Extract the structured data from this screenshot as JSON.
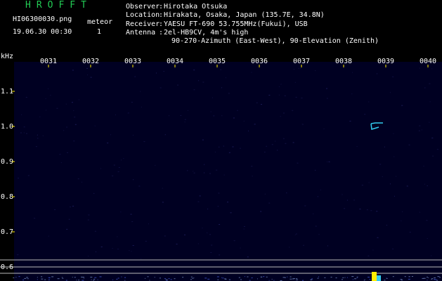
{
  "header": {
    "app_title": "HROFFT",
    "filename": "HI06300030.png",
    "datetime": "19.06.30 00:30",
    "meteor_label": "meteor",
    "meteor_count": "1"
  },
  "station": {
    "observer_label": "Observer",
    "observer": "Hirotaka Otsuka",
    "location_label": "Location",
    "location": "Hirakata, Osaka, Japan (135.7E, 34.8N)",
    "receiver_label": "Receiver",
    "receiver": "YAESU FT-690 53.755MHz(Fukui), USB",
    "antenna_label": "Antenna",
    "antenna_line1": "2el-HB9CV, 4m's high",
    "antenna_line2": "90-270-Azimuth (East-West), 90-Elevation (Zenith)"
  },
  "colors": {
    "background": "#000000",
    "plot_background": "#000022",
    "title_green": "#22cc55",
    "text": "#ffffff",
    "echo_cyan": "#33ccee",
    "marker_yellow": "#ffee00"
  },
  "chart_data": {
    "type": "heatmap",
    "ylabel": "kHz",
    "x_ticks": [
      "0031",
      "0032",
      "0033",
      "0034",
      "0035",
      "0036",
      "0037",
      "0038",
      "0039",
      "0040"
    ],
    "y_ticks": [
      "1.1",
      "1.0",
      "0.9",
      "0.8",
      "0.7",
      "0.6"
    ],
    "x_range": [
      30,
      40
    ],
    "y_range": [
      0.575,
      1.19
    ],
    "detections": [
      {
        "name": "meteor echo",
        "minute": 38.7,
        "khz": 1.0
      }
    ]
  }
}
